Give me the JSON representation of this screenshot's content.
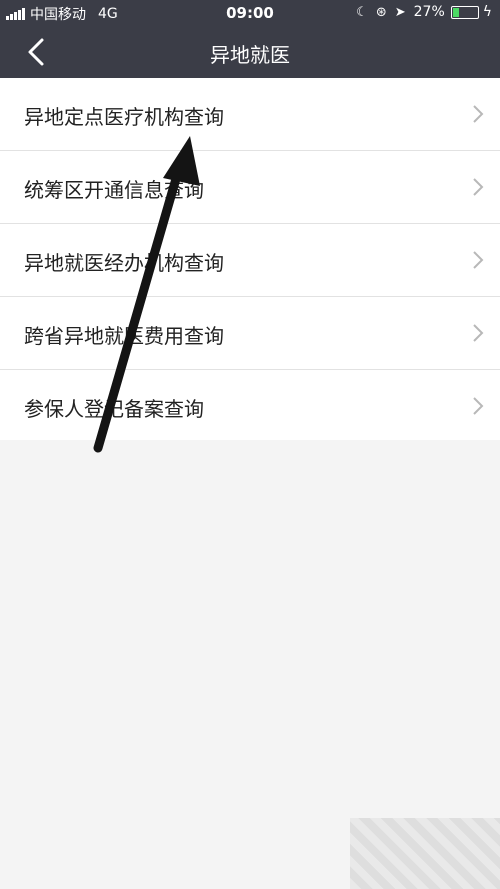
{
  "status_bar": {
    "carrier": "中国移动",
    "network": "4G",
    "time": "09:00",
    "battery_text": "27%",
    "battery_level": 0.27,
    "icons": [
      "moon-icon",
      "rotation-lock-icon",
      "location-icon",
      "charging-bolt-icon"
    ]
  },
  "nav": {
    "title": "异地就医",
    "back_icon": "chevron-left-icon"
  },
  "menu": {
    "items": [
      {
        "label": "异地定点医疗机构查询"
      },
      {
        "label": "统筹区开通信息查询"
      },
      {
        "label": "异地就医经办机构查询"
      },
      {
        "label": "跨省异地就医费用查询"
      },
      {
        "label": "参保人登记备案查询"
      }
    ]
  },
  "colors": {
    "header_bg": "#3b3d47",
    "page_bg": "#f4f4f4",
    "battery": "#4cd964"
  }
}
